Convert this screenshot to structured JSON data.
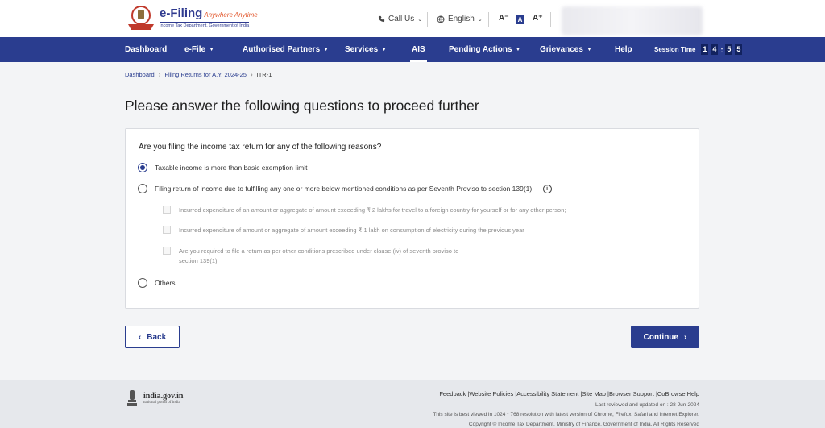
{
  "header": {
    "logo_brand": "e-Filing",
    "logo_tagline": "Anywhere Anytime",
    "logo_sub": "Income Tax Department, Government of India",
    "call_us": "Call Us",
    "language": "English",
    "font_decrease": "A⁻",
    "font_normal": "A",
    "font_increase": "A⁺"
  },
  "nav": {
    "items": [
      {
        "label": "Dashboard"
      },
      {
        "label": "e-File"
      },
      {
        "label": "Authorised Partners"
      },
      {
        "label": "Services"
      },
      {
        "label": "AIS"
      },
      {
        "label": "Pending Actions"
      },
      {
        "label": "Grievances"
      },
      {
        "label": "Help"
      }
    ],
    "session_label": "Session Time",
    "session_digits": [
      "1",
      "4",
      "5",
      "5"
    ]
  },
  "breadcrumb": {
    "items": [
      "Dashboard",
      "Filing Returns for A.Y. 2024-25",
      "ITR-1"
    ]
  },
  "page_title": "Please answer the following questions to proceed further",
  "question": {
    "text": "Are you filing the income tax return for any of the following reasons?",
    "options": [
      {
        "label": "Taxable income is more than basic exemption limit",
        "selected": true
      },
      {
        "label": "Filing return of income due to fulfilling any one or more below mentioned conditions as per Seventh Proviso to section 139(1):",
        "selected": false
      },
      {
        "label": "Others",
        "selected": false
      }
    ],
    "sub_conditions": [
      {
        "line1": "Incurred expenditure of an amount or aggregate of amount exceeding ₹ 2 lakhs for travel to a foreign country for yourself or for any other person;"
      },
      {
        "line1": "Incurred expenditure of amount or aggregate of amount exceeding ₹ 1 lakh on consumption of electricity during the previous year"
      },
      {
        "line1": "Are you required to file a return as per other conditions prescribed under clause (iv) of seventh proviso to",
        "line2": "section 139(1)"
      }
    ]
  },
  "buttons": {
    "back": "Back",
    "continue": "Continue"
  },
  "footer": {
    "gov_name": "india.gov.in",
    "gov_sub": "national portal of india",
    "links": "Feedback |Website Policies |Accessibility Statement |Site Map |Browser Support |CoBrowse Help",
    "last_reviewed": "Last reviewed and updated on : 28-Jun-2024",
    "best_viewed": "This site is best viewed in 1024 * 768 resolution with latest version of Chrome, Firefox, Safari and Internet Explorer.",
    "copyright": "Copyright © Income Tax Department, Ministry of Finance, Government of India. All Rights Reserved"
  },
  "colors": {
    "primary": "#2a3d8f",
    "accent": "#e2562b"
  }
}
